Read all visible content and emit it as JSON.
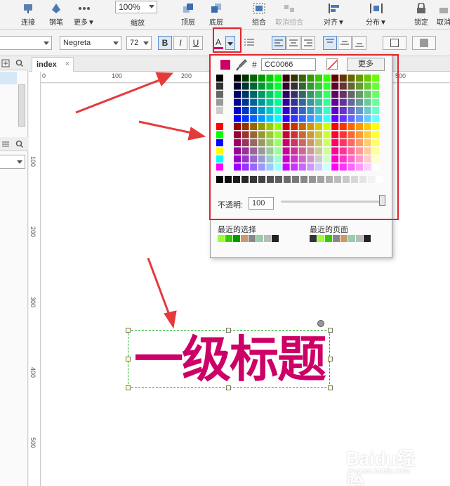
{
  "toolbar": {
    "connect": "连接",
    "pen": "钢笔",
    "more": "更多▼",
    "zoom_value": "100%",
    "zoom_label": "缩放",
    "top_layer": "顶层",
    "bottom_layer": "底层",
    "group": "组合",
    "ungroup": "取消组合",
    "align": "对齐▼",
    "distribute": "分布▼",
    "lock": "锁定",
    "unlock": "取消"
  },
  "format": {
    "font_family": "Negreta",
    "font_size": "72",
    "bold": "B",
    "italic": "I",
    "underline": "U",
    "font_color": "A"
  },
  "tab": {
    "label": "index",
    "close": "×"
  },
  "ruler": {
    "h": [
      "0",
      "100",
      "200",
      "500"
    ],
    "v": [
      "100",
      "200",
      "300",
      "400",
      "500"
    ]
  },
  "picker": {
    "current_color": "#CC0066",
    "hash": "#",
    "hex_value": "CC0066",
    "more_label": "更多",
    "opacity_label": "不透明:",
    "opacity_value": "100",
    "opacity_level": 1.0,
    "recent_selected_label": "最近的选择",
    "recent_page_label": "最近的页面",
    "recent_selected": [
      "#99ff33",
      "#33cc00",
      "#009900",
      "#cc9966",
      "#888888",
      "#99ccaa",
      "#bbbbbb",
      "#222222"
    ],
    "recent_page": [
      "#333333",
      "#99ff33",
      "#33cc00",
      "#888888",
      "#cc9966",
      "#99ccaa",
      "#bbbbbb",
      "#222222"
    ]
  },
  "canvas": {
    "heading_text": "一级标题",
    "heading_color": "#CC0066"
  },
  "watermark": {
    "brand": "Baidu经验",
    "url": "jingyan.baidu.com"
  },
  "colors": {
    "highlight": "#e0242b",
    "selection": "#1ab21a"
  }
}
